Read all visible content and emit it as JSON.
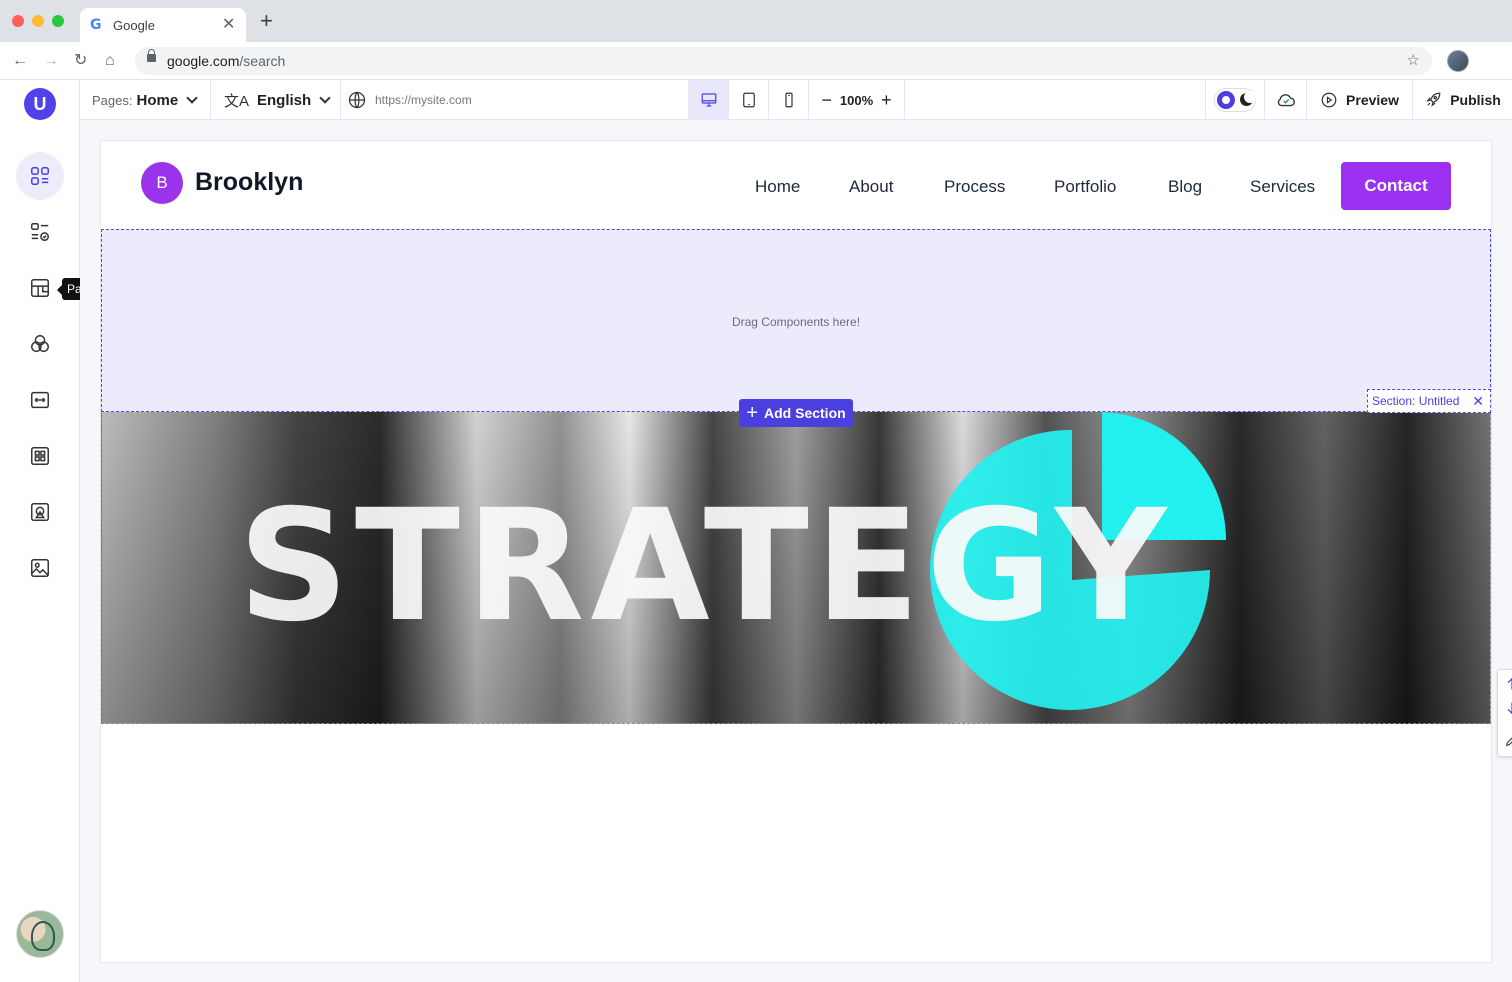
{
  "browser": {
    "tab_title": "Google",
    "url_host": "google.com",
    "url_path": "/search"
  },
  "toolbar": {
    "pages_label": "Pages:",
    "pages_value": "Home",
    "language": "English",
    "site_url": "https://mysite.com",
    "zoom": "100%",
    "preview_label": "Preview",
    "publish_label": "Publish"
  },
  "sidebar": {
    "logo": "U",
    "tooltip": "Pages",
    "items": [
      "dashboard-icon",
      "components-icon",
      "pages-icon",
      "styles-icon",
      "spacing-icon",
      "widgets-icon",
      "media-shapes-icon",
      "image-icon"
    ]
  },
  "site": {
    "logo_letter": "B",
    "name": "Brooklyn",
    "nav": [
      "Home",
      "About",
      "Process",
      "Portfolio",
      "Blog",
      "Services"
    ],
    "cta": "Contact"
  },
  "editor": {
    "drop_text": "Drag Components here!",
    "add_section": "Add Section",
    "section_label": "Section: Untitled"
  },
  "hero": {
    "word": "STRATEGY",
    "accent_color": "#22f0ee"
  },
  "colors": {
    "brand": "#5141e8",
    "site_accent": "#9b30f0"
  }
}
